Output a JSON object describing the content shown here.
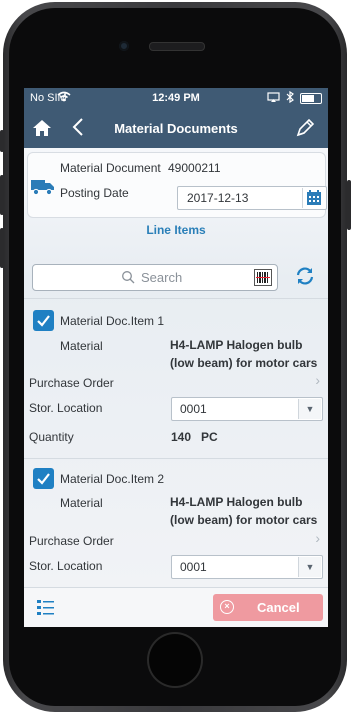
{
  "status_bar": {
    "carrier": "No SIM",
    "time": "12:49 PM"
  },
  "nav": {
    "title": "Material Documents"
  },
  "header": {
    "doc_label": "Material Document",
    "doc_number": "49000211",
    "posting_label": "Posting Date",
    "posting_date": "2017-12-13"
  },
  "tabs": {
    "line_items": "Line Items"
  },
  "search": {
    "placeholder": "Search"
  },
  "items": [
    {
      "title": "Material Doc.Item 1",
      "material_label": "Material",
      "material_value": "H4-LAMP Halogen bulb (low beam) for motor cars",
      "purchase_order_label": "Purchase Order",
      "stor_location_label": "Stor. Location",
      "stor_location_value": "0001",
      "quantity_label": "Quantity",
      "quantity_value": "140",
      "quantity_unit": "PC"
    },
    {
      "title": "Material Doc.Item 2",
      "material_label": "Material",
      "material_value": "H4-LAMP Halogen bulb (low beam) for motor cars",
      "purchase_order_label": "Purchase Order",
      "stor_location_label": "Stor. Location",
      "stor_location_value": "0001"
    }
  ],
  "footer": {
    "cancel_label": "Cancel"
  },
  "colors": {
    "navbar": "#3f5a74",
    "accent": "#1f80c3",
    "cancel": "#ef9aa0"
  }
}
